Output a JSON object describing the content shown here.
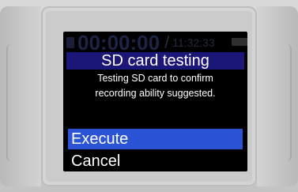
{
  "background_status": {
    "record_time": "00:00:00",
    "remaining_time": "11:32:33"
  },
  "dialog": {
    "title": "SD card testing",
    "message_line1": "Testing SD card to confirm",
    "message_line2": "recording ability suggested.",
    "options": [
      {
        "label": "Execute",
        "selected": true
      },
      {
        "label": "Cancel",
        "selected": false
      }
    ]
  },
  "colors": {
    "title_bar": "#1b1779",
    "selection": "#2a54d5",
    "screen_bg": "#000000",
    "device_body": "#cfcfcf"
  }
}
